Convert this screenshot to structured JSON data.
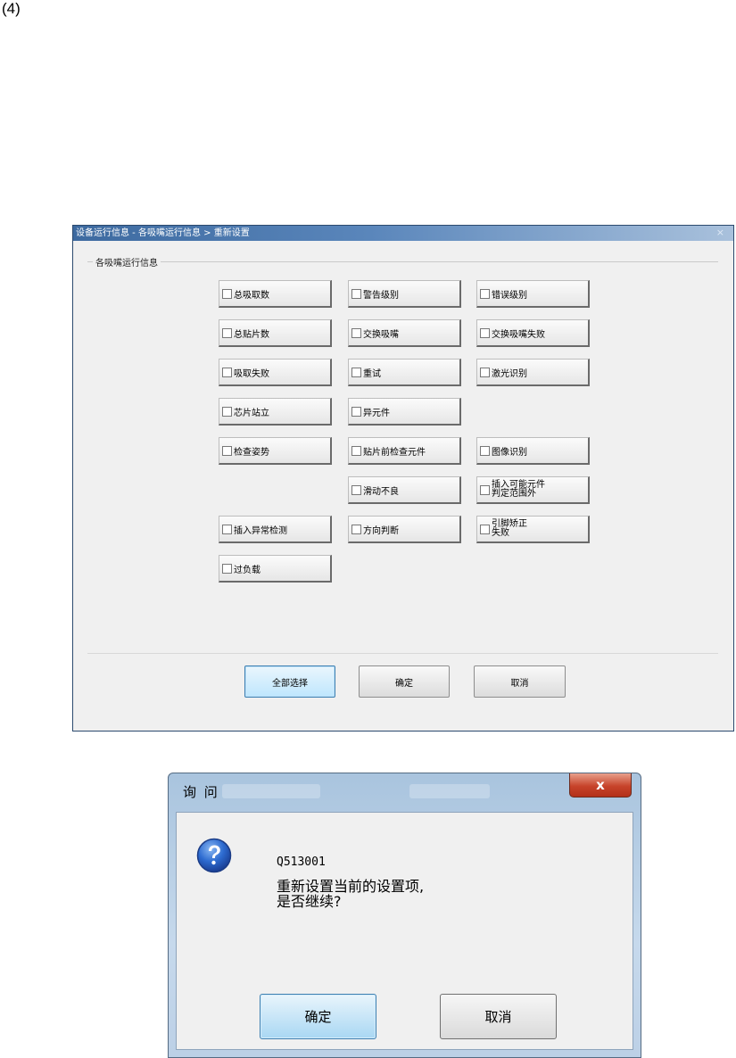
{
  "figure_label": "(4)",
  "settings_window": {
    "title": "设备运行信息 - 各吸嘴运行信息 > 重新设置",
    "close_glyph": "×",
    "group_label": "各吸嘴运行信息",
    "options": {
      "zong_xiqu_shu": "总吸取数",
      "jinggao_jibie": "警告级别",
      "cuowu_jibie": "错误级别",
      "zong_tiepian_shu": "总贴片数",
      "jiaohuan_xizui": "交换吸嘴",
      "jiaohuan_xizui_shibai": "交换吸嘴失败",
      "xiqu_shibai": "吸取失败",
      "chongshi": "重试",
      "jiguang_shibie": "激光识别",
      "xinpian_zhanli": "芯片站立",
      "yi_yuanjian": "异元件",
      "jiancha_zishi": "检查姿势",
      "tiepian_qian_jiancha": "贴片前检查元件",
      "tuxiang_shibie": "图像识别",
      "huadong_buliang": "滑动不良",
      "charu_kejian_line1": "插入可能元件",
      "charu_kejian_line2": "判定范围外",
      "charu_yichang": "插入异常检测",
      "fangxiang_panduan": "方向判断",
      "yinjiao_jiaozheng_line1": "引脚矫正",
      "yinjiao_jiaozheng_line2": "失败",
      "guo_fuzai": "过负载"
    },
    "buttons": {
      "select_all": "全部选择",
      "ok": "确定",
      "cancel": "取消"
    }
  },
  "confirm_dialog": {
    "title": "询 问",
    "close_glyph": "x",
    "icon": "question-icon",
    "code": "Q513001",
    "message_line1": "重新设置当前的设置项,",
    "message_line2": "是否继续?",
    "buttons": {
      "ok": "确定",
      "cancel": "取消"
    }
  }
}
